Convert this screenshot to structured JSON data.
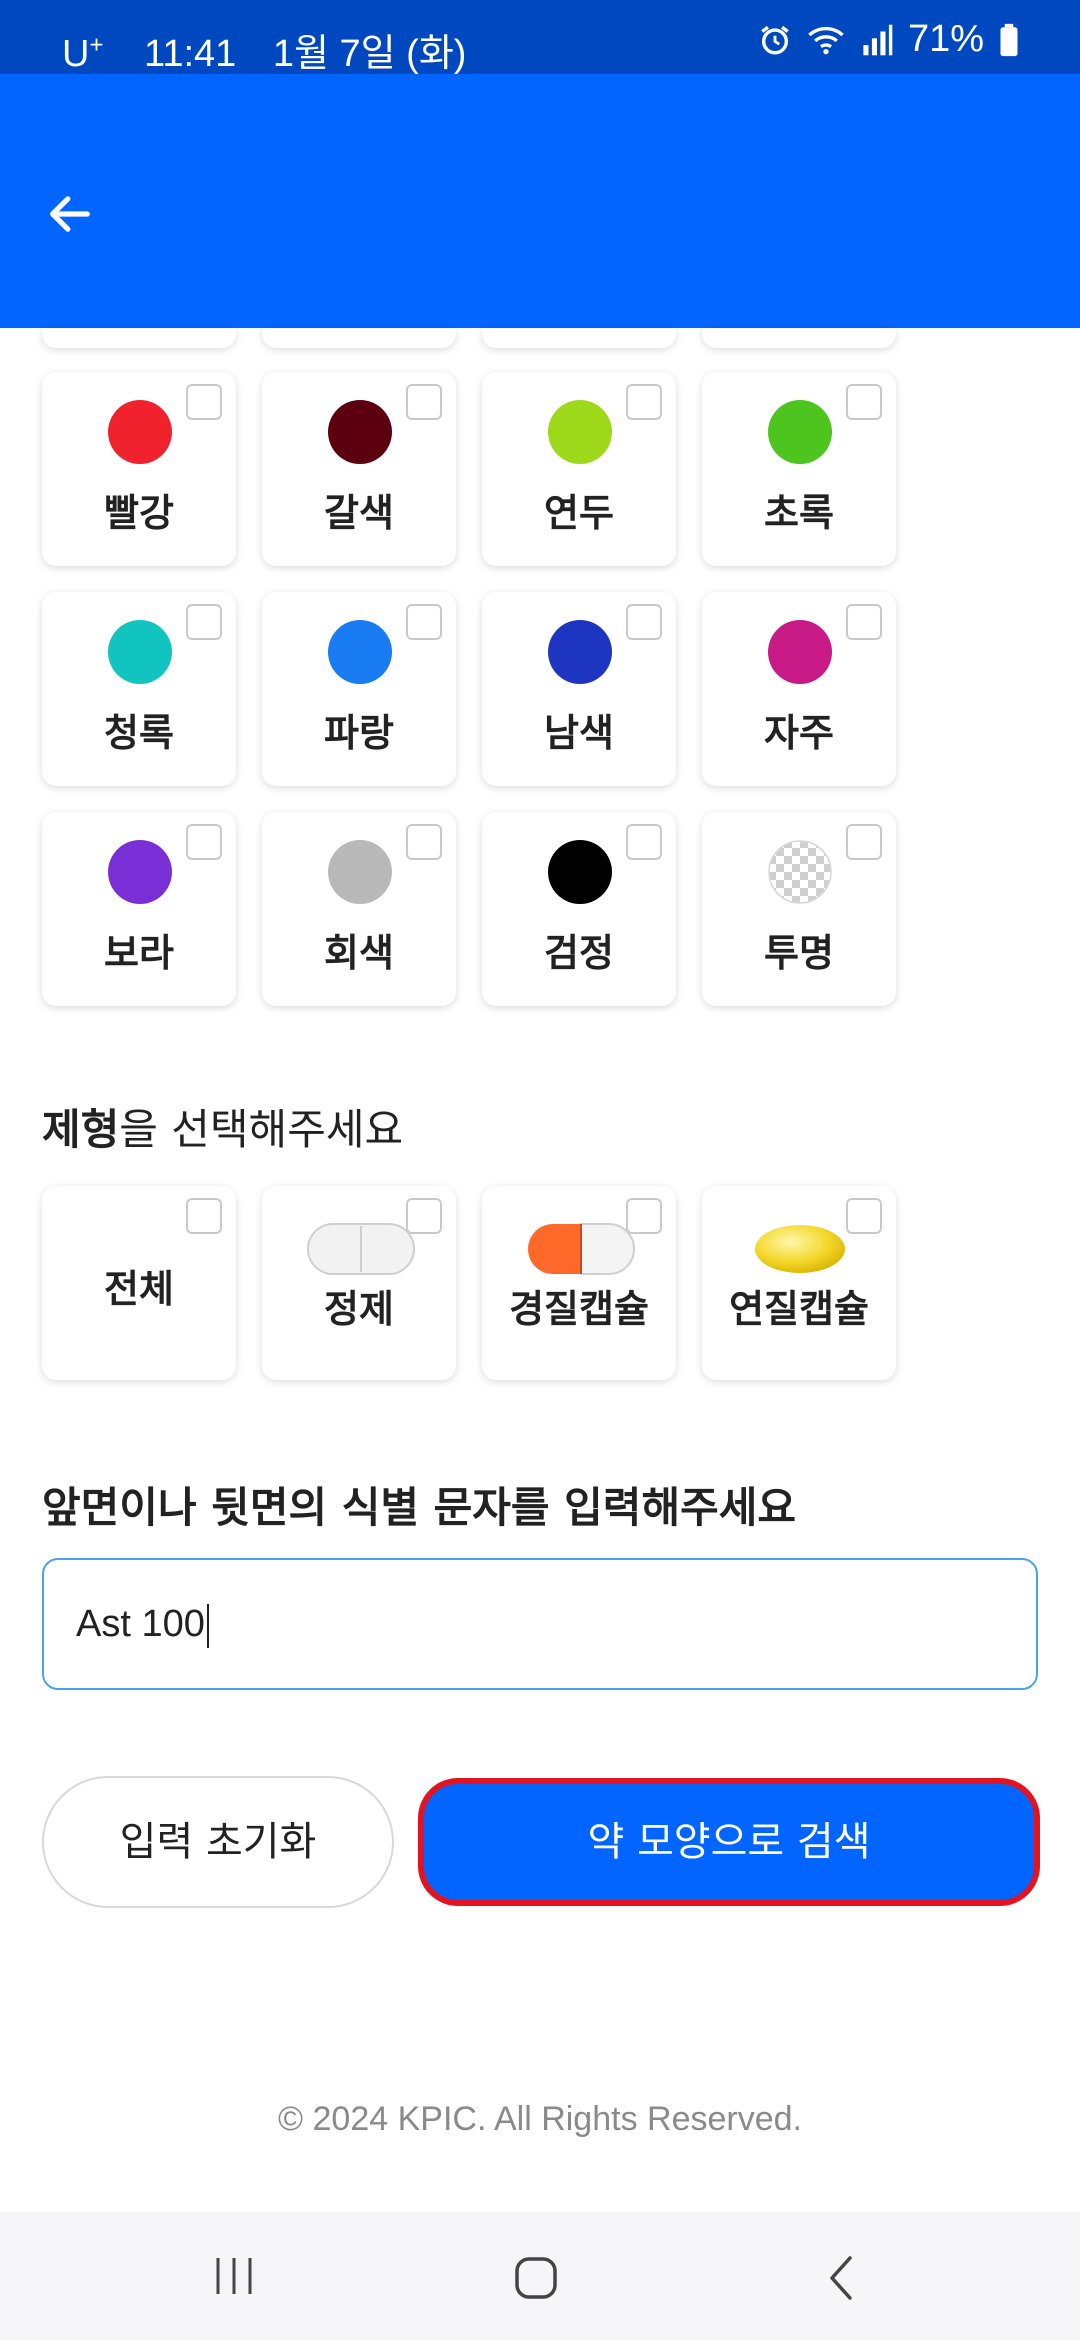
{
  "status_bar": {
    "carrier": "U",
    "carrier_sup": "+",
    "time": "11:41",
    "date": "1월 7일 (화)",
    "battery": "71%",
    "icons": [
      "alarm-icon",
      "wifi-icon",
      "signal-icon",
      "battery-icon"
    ]
  },
  "app_bar": {
    "back_icon": "arrow-left-icon",
    "color": "#0265ff"
  },
  "colors": [
    {
      "label": "빨강",
      "hex": "#f0222e"
    },
    {
      "label": "갈색",
      "hex": "#5c0010"
    },
    {
      "label": "연두",
      "hex": "#9ed81a"
    },
    {
      "label": "초록",
      "hex": "#4ec41f"
    },
    {
      "label": "청록",
      "hex": "#12c4c0"
    },
    {
      "label": "파랑",
      "hex": "#1a7cf2"
    },
    {
      "label": "남색",
      "hex": "#1d35c0"
    },
    {
      "label": "자주",
      "hex": "#c71a86"
    },
    {
      "label": "보라",
      "hex": "#7a2fd6"
    },
    {
      "label": "회색",
      "hex": "#b9b9b9"
    },
    {
      "label": "검정",
      "hex": "#000000"
    },
    {
      "label": "투명",
      "hex": "transparent"
    }
  ],
  "shape_section": {
    "title_bold": "제형",
    "title_rest": "을 선택해주세요",
    "items": [
      {
        "label": "전체",
        "icon": ""
      },
      {
        "label": "정제",
        "icon": "tablet-icon"
      },
      {
        "label": "경질캡슐",
        "icon": "hard-capsule-icon"
      },
      {
        "label": "연질캡슐",
        "icon": "soft-capsule-icon"
      }
    ]
  },
  "mark_section": {
    "title": "앞면이나 뒷면의 식별 문자를 입력해주세요",
    "input_value": "Ast 100"
  },
  "buttons": {
    "reset": "입력 초기화",
    "search": "약 모양으로 검색"
  },
  "footer": "© 2024 KPIC. All Rights Reserved.",
  "nav_bar": {
    "icons": [
      "recent-apps-icon",
      "home-icon",
      "back-nav-icon"
    ]
  }
}
